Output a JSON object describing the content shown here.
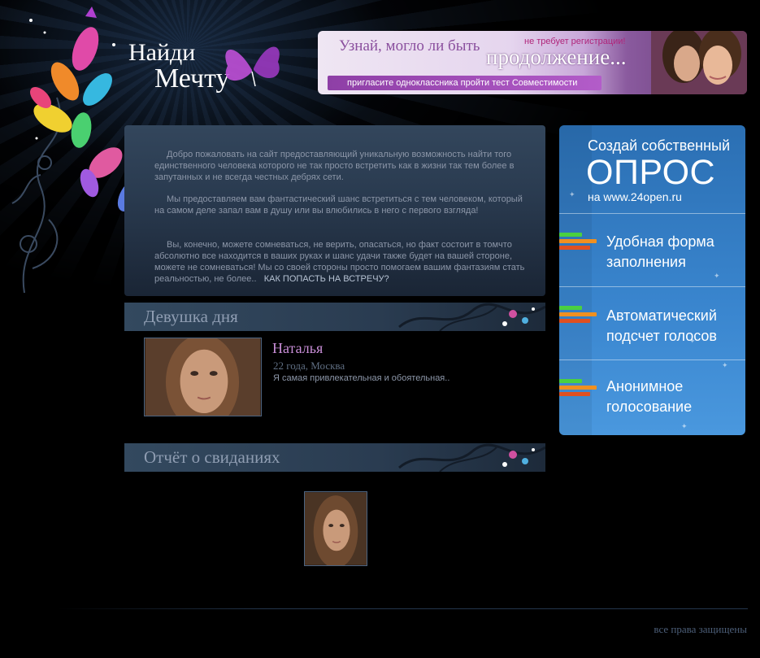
{
  "logo": {
    "line1": "Найди",
    "line2": "Мечту"
  },
  "banner": {
    "text1": "Узнай, могло ли быть",
    "no_registration": "не требует регистрации!",
    "text2": "продолжение...",
    "cta": "пригласите одноклассника пройти тест Совместимости"
  },
  "welcome": {
    "paragraph1": "Добро пожаловать на сайт предоставляющий уникальную возможность найти того единственного человека которого не так просто встретить как в жизни так тем более в запутанных и не всегда честных дебрях сети.",
    "paragraph2": "Мы предоставляем вам фантастический шанс встретиться с тем человеком, который на самом деле запал вам в душу или вы влюбились в него с первого взгляда!",
    "paragraph3": "Вы, конечно, можете сомневаться, не верить, опасаться, но факт состоит в томчто абсолютно все находится в ваших руках и шанс удачи также будет на вашей стороне, можете не сомневаться! Мы со своей стороны просто помогаем вашим фантазиям стать реальностью, не более..",
    "link": "КАК ПОПАСТЬ НА ВСТРЕЧУ?"
  },
  "girl_of_day": {
    "heading": "Девушка дня",
    "name": "Наталья",
    "age_city": "22 года, Москва",
    "description": "Я самая привлекательная и обоятельная.."
  },
  "dates_report": {
    "heading": "Отчёт о свиданиях"
  },
  "poll_ad": {
    "line1": "Создай собственный",
    "line2": "ОПРОС",
    "line3": "на www.24open.ru",
    "features": [
      {
        "line1": "Удобная форма",
        "line2": "заполнения"
      },
      {
        "line1": "Автоматический",
        "line2": "подсчет голосов"
      },
      {
        "line1": "Анонимное",
        "line2": "голосование"
      }
    ]
  },
  "footer": {
    "copyright": "все права защищены"
  },
  "colors": {
    "accent_purple": "#c98ed8",
    "poll_blue": "#3a86cf",
    "bg": "#000000"
  }
}
